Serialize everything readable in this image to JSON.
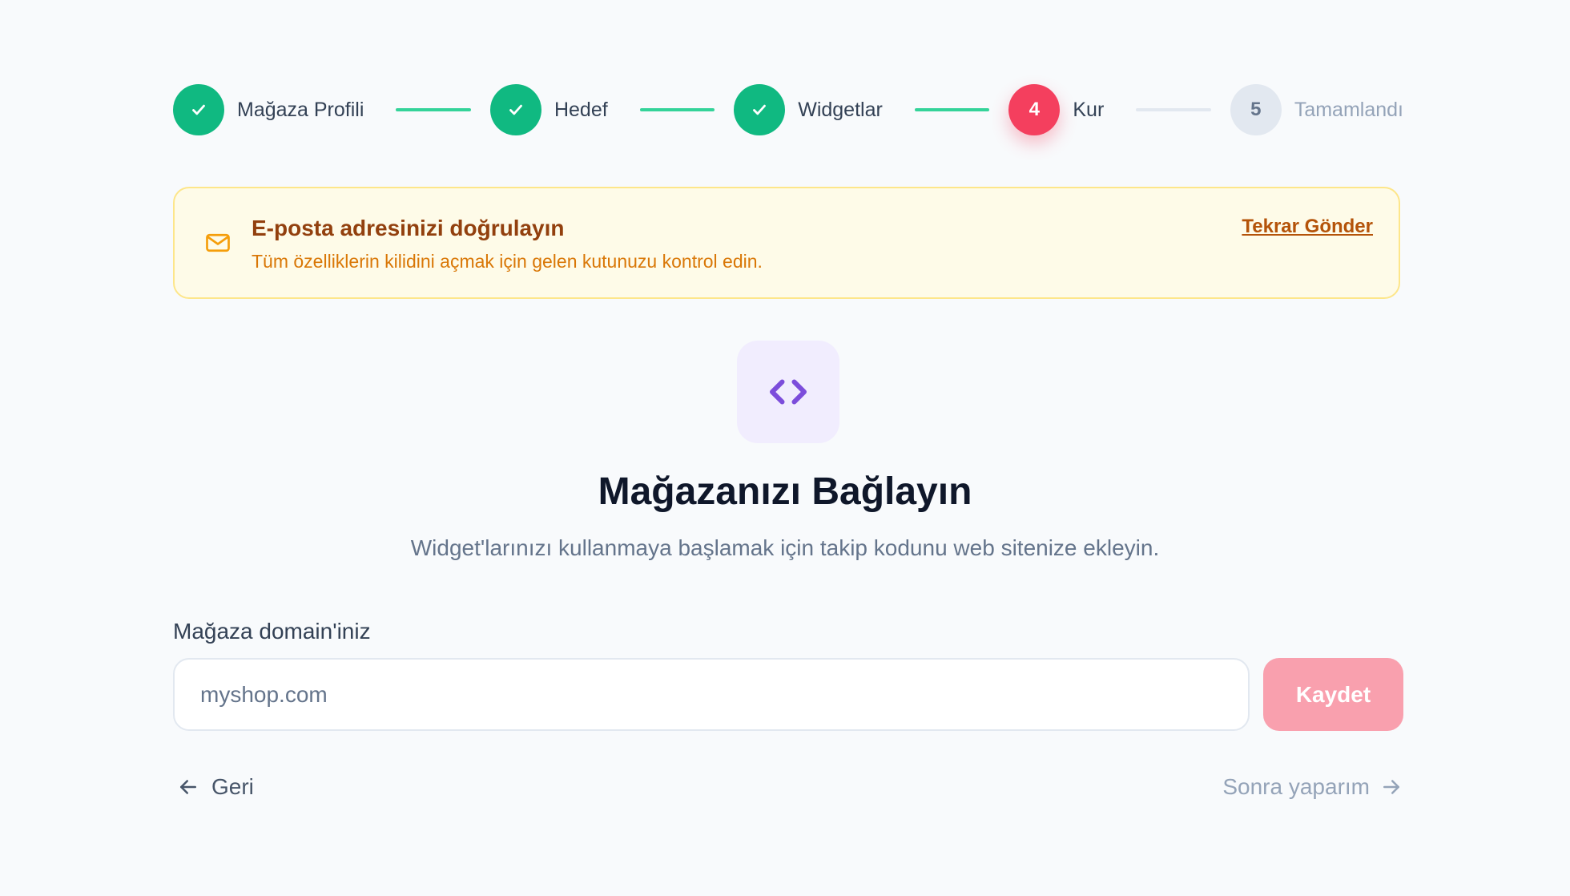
{
  "stepper": {
    "steps": [
      {
        "number": "1",
        "label": "Mağaza Profili",
        "status": "done"
      },
      {
        "number": "2",
        "label": "Hedef",
        "status": "done"
      },
      {
        "number": "3",
        "label": "Widgetlar",
        "status": "done"
      },
      {
        "number": "4",
        "label": "Kur",
        "status": "current"
      },
      {
        "number": "5",
        "label": "Tamamlandı",
        "status": "upcoming"
      }
    ]
  },
  "alert": {
    "icon": "mail-icon",
    "title": "E-posta adresinizi doğrulayın",
    "message": "Tüm özelliklerin kilidini açmak için gelen kutunuzu kontrol edin.",
    "action_label": "Tekrar Gönder"
  },
  "main": {
    "icon": "code-icon",
    "title": "Mağazanızı Bağlayın",
    "subtitle": "Widget'larınızı kullanmaya başlamak için takip kodunu web sitenize ekleyin."
  },
  "domain_form": {
    "label": "Mağaza domain'iniz",
    "placeholder": "myshop.com",
    "value": "",
    "save_label": "Kaydet"
  },
  "navigation": {
    "back_label": "Geri",
    "skip_label": "Sonra yaparım"
  },
  "colors": {
    "success": "#10b981",
    "accent": "#f43f5e",
    "accent_disabled": "#f9a0ae",
    "warning_bg": "#fefbe8",
    "warning_border": "#fde68a",
    "code_icon": "#7c4ddb"
  }
}
